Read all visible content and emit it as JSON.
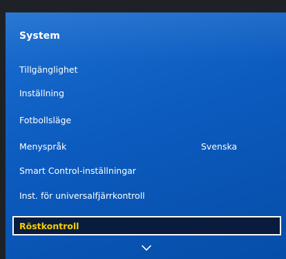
{
  "menu": {
    "title": "System",
    "items": [
      {
        "label": "Tillgänglighet",
        "value": ""
      },
      {
        "label": "Inställning",
        "value": ""
      },
      {
        "label": "Fotbollsläge",
        "value": ""
      },
      {
        "label": "Menyspråk",
        "value": "Svenska"
      },
      {
        "label": "Smart Control-inställningar",
        "value": ""
      },
      {
        "label": "Inst. för universalfjärrkontroll",
        "value": ""
      },
      {
        "label": "Röstkontroll",
        "value": ""
      }
    ],
    "selected_index": 6,
    "scroll_icon": "chevron-down-icon"
  },
  "colors": {
    "panel_blue": "#0c5bbf",
    "selected_bg": "#0a1c3e",
    "selected_text": "#f5d000",
    "text": "#ffffff",
    "backdrop": "#1e2226"
  }
}
